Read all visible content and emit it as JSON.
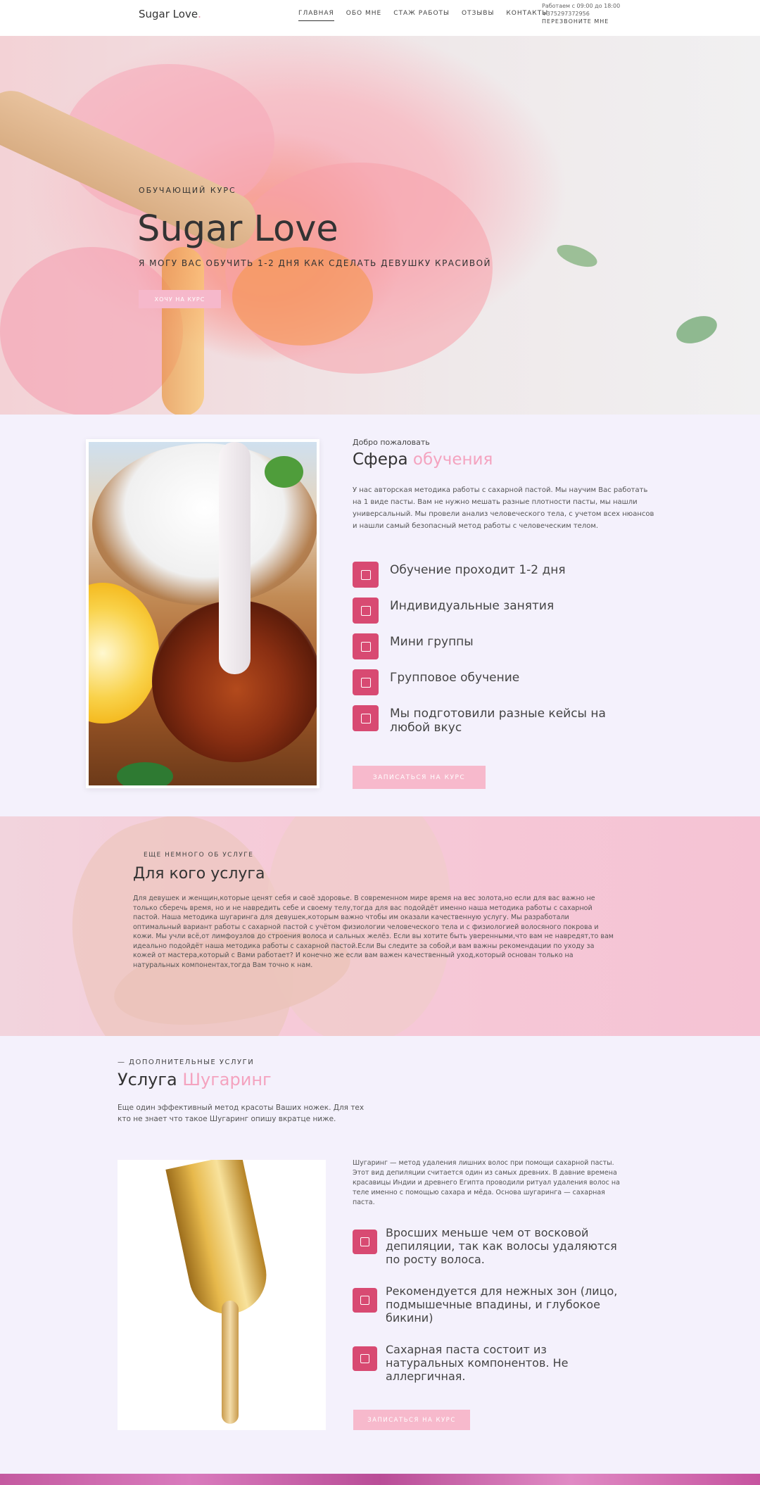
{
  "header": {
    "logo": "Sugar Love",
    "logo_dot": ".",
    "nav": [
      "ГЛАВНАЯ",
      "ОБО МНЕ",
      "СТАЖ РАБОТЫ",
      "ОТЗЫВЫ",
      "КОНТАКТЫ"
    ],
    "hours": "Работаем с 09:00 до 18:00",
    "phone": "+375297372956",
    "callback": "ПЕРЕЗВОНИТЕ МНЕ"
  },
  "hero": {
    "subtitle": "ОБУЧАЮЩИЙ КУРС",
    "title": "Sugar Love",
    "tagline": "Я МОГУ ВАС ОБУЧИТЬ 1-2 ДНЯ КАК СДЕЛАТЬ ДЕВУШКУ КРАСИВОЙ",
    "button": "ХОЧУ НА КУРС"
  },
  "sphere": {
    "welcome": "Добро пожаловать",
    "title_main": "Сфера",
    "title_accent": "обучения",
    "text": "У нас авторская методика работы с сахарной пастой. Мы научим Вас работать на 1 виде пасты. Вам не нужно мешать разные плотности пасты, мы нашли универсальный. Мы провели анализ человеческого тела, с учетом всех нюансов и нашли самый безопасный метод работы с человеческим телом.",
    "features": [
      {
        "icon": "image-icon",
        "label": "Обучение проходит 1-2 дня"
      },
      {
        "icon": "layout-icon",
        "label": "Индивидуальные занятия"
      },
      {
        "icon": "camera-icon",
        "label": "Мини группы"
      },
      {
        "icon": "utensils-icon",
        "label": "Групповое обучение"
      },
      {
        "icon": "utensils-icon",
        "label": "Мы подготовили разные кейсы на любой вкус"
      }
    ],
    "button": "ЗАПИСАТЬСЯ НА КУРС"
  },
  "band": {
    "subtitle": "ЕЩЕ НЕМНОГО ОБ УСЛУГЕ",
    "title": "Для кого услуга",
    "text": "Для девушек и женщин,которые ценят себя и своё здоровье. В современном мире время на вес золота,но если для вас важно не только сберечь время, но и не навредить себе и своему телу,тогда для вас подойдёт именно наша методика работы с сахарной пастой. Наша методика шугаринга для девушек,которым важно чтобы им оказали качественную услугу. Мы разработали оптимальный вариант работы с сахарной пастой с учётом физиологии человеческого тела и с физиологией волосяного покрова и кожи. Мы учли всё,от лимфоузлов до строения волоса и сальных желёз. Если вы хотите быть уверенными,что вам не навредят,то вам идеально подойдёт наша методика работы с сахарной пастой.Если Вы следите за собой,и вам важны рекомендации по уходу за кожей от мастера,который с Вами работает? И конечно же если вам важен качественный уход,который основан только на натуральных компонентах,тогда Вам точно к нам."
  },
  "extra": {
    "subtitle": "— ДОПОЛНИТЕЛЬНЫЕ УСЛУГИ",
    "title_main": "Услуга",
    "title_accent": "Шугаринг",
    "text": "Еще один эффективный метод красоты Ваших ножек. Для тех кто не знает что такое Шугаринг опишу вкратце ниже.",
    "detail": "Шугаринг — метод удаления лишних волос при помощи сахарной пасты. Этот вид депиляции считается один из самых древних. В давние времена красавицы Индии и древнего Египта проводили ритуал удаления волос на теле именно с помощью сахара и мёда. Основа шугаринга — сахарная паста.",
    "features": [
      {
        "icon": "image-icon",
        "label": "Вросших меньше чем от восковой депиляции, так как волосы удаляются по росту волоса."
      },
      {
        "icon": "layout-icon",
        "label": "Рекомендуется для нежных зон (лицо, подмышечные впадины, и глубокое бикини)"
      },
      {
        "icon": "camera-icon",
        "label": "Сахарная паста состоит из натуральных компонентов. Не аллергичная."
      }
    ],
    "button": "ЗАПИСАТЬСЯ НА КУРС"
  }
}
